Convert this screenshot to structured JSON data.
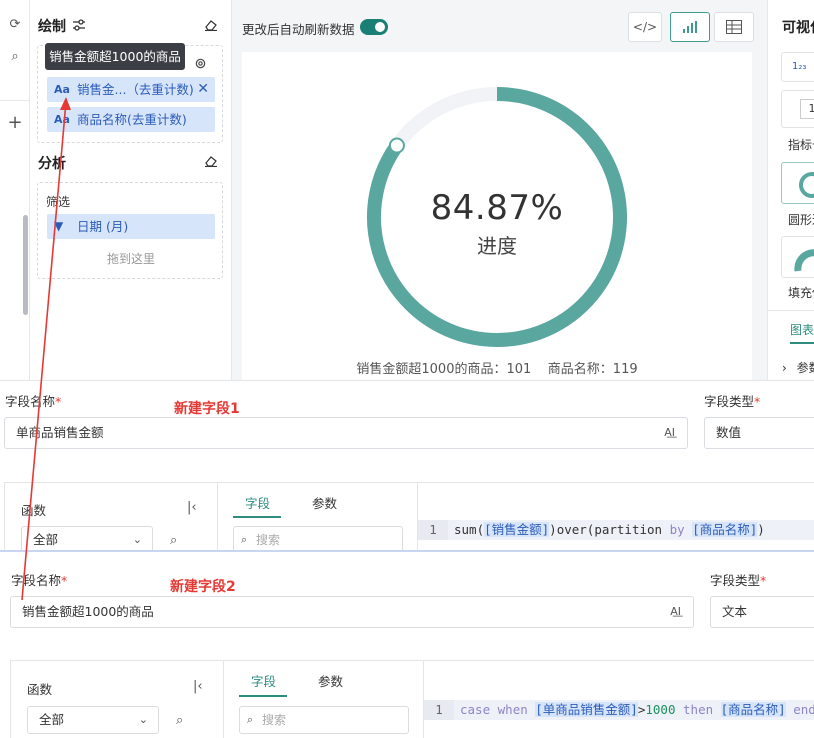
{
  "top": {
    "config": {
      "draw_title": "绘制",
      "analysis_title": "分析",
      "tooltip": "销售金额超1000的商品",
      "pills": [
        {
          "icon": "Aa",
          "label": "销售金...（去重计数)"
        },
        {
          "icon": "Aa",
          "label": "商品名称(去重计数)"
        }
      ],
      "filter_label": "筛选",
      "filter_pill": "日期 (月)",
      "drop_hint": "拖到这里"
    },
    "canvas": {
      "toggle_label": "更改后自动刷新数据",
      "toolbar": {
        "code": "</>",
        "chart": "▁▃▅",
        "table": "▦"
      },
      "gauge": {
        "percent_text": "84.87%",
        "label": "进度",
        "progress": 0.8487
      },
      "footer": "销售金额超1000的商品：101    商品名称：119"
    },
    "right_panel": {
      "title": "可视化",
      "card1_text": "1₂₃",
      "card2_text": "1",
      "label1": "指标卡",
      "label2": "圆形进度",
      "label3": "填充仪表",
      "tab": "图表",
      "row": "参数"
    },
    "colors": {
      "accent": "#5aa7a0",
      "track": "#f1f3f6",
      "pill_bg": "#d7e5fb",
      "pill_text": "#2b5cb8"
    }
  },
  "form1": {
    "field_name_label": "字段名称",
    "field_name_value": "单商品销售金额",
    "red_title": "新建字段1",
    "field_type_label": "字段类型",
    "field_type_value": "数值",
    "func_title": "函数",
    "func_select": "全部",
    "tab_fields": "字段",
    "tab_params": "参数",
    "search_placeholder": "搜索",
    "line_no": "1",
    "code": {
      "p1": "sum(",
      "f1": "[销售金额]",
      "p2": ")over(partition ",
      "kw": "by",
      "p3": " ",
      "f2": "[商品名称]",
      "p4": ")"
    }
  },
  "form2": {
    "field_name_label": "字段名称",
    "field_name_value": "销售金额超1000的商品",
    "red_title": "新建字段2",
    "field_type_label": "字段类型",
    "field_type_value": "文本",
    "func_title": "函数",
    "func_select": "全部",
    "tab_fields": "字段",
    "tab_params": "参数",
    "search_placeholder": "搜索",
    "line_no": "1",
    "code": {
      "kw1": "case",
      "s1": " ",
      "kw2": "when",
      "s2": " ",
      "f1": "[单商品销售金额]",
      "op": ">",
      "num": "1000",
      "s3": " ",
      "kw3": "then",
      "s4": " ",
      "f2": "[商品名称]",
      "s5": " ",
      "kw4": "end"
    }
  },
  "annotation_color": "#e53935"
}
